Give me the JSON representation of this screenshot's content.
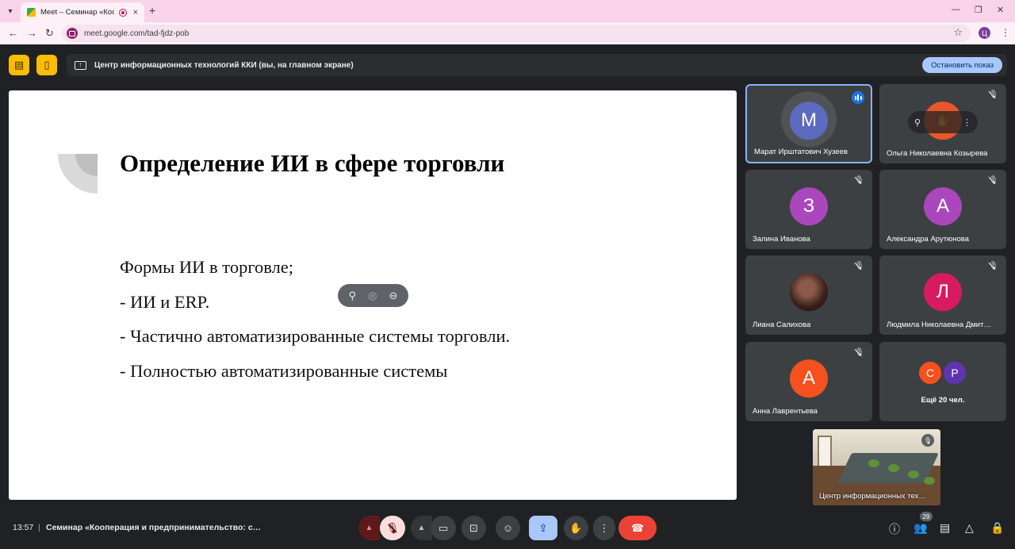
{
  "browser": {
    "tab_title": "Meet – Семинар «Коопера",
    "tab_close": "×",
    "new_tab": "+",
    "url": "meet.google.com/tad-fjdz-pob",
    "profile_initial": "Ц",
    "tab_menu_icon": "chevron-down-icon",
    "window_controls": [
      "minimize-icon",
      "restore-icon",
      "close-icon"
    ]
  },
  "presenting": {
    "banner_text": "Центр информационных технологий ККИ (вы, на главном экране)",
    "stop_label": "Остановить показ"
  },
  "slide": {
    "title": "Определение ИИ в сфере торговли",
    "lines": [
      "Формы ИИ в торговле;",
      "- ИИ и ERP.",
      "- Частично автоматизированные системы торговли.",
      "- Полностью автоматизированные системы"
    ]
  },
  "participants": [
    {
      "initial": "М",
      "name": "Марат Ирштатович Хузеев",
      "color": "#5c6bc0",
      "speaking": true
    },
    {
      "initial": "",
      "name": "Ольга Николаевна Козырева",
      "color": "#e8572a",
      "muted": true
    },
    {
      "initial": "З",
      "name": "Залина Иванова",
      "color": "#ab47bc",
      "muted": true
    },
    {
      "initial": "А",
      "name": "Александра Арутюнова",
      "color": "#ab47bc",
      "muted": true
    },
    {
      "initial": "",
      "name": "Лиана Салихова",
      "color": "#3a1f1a",
      "muted": true
    },
    {
      "initial": "Л",
      "name": "Людмила Николаевна Дмит…",
      "color": "#d81b60",
      "muted": true
    },
    {
      "initial": "А",
      "name": "Анна Лаврентьева",
      "color": "#f4511e",
      "muted": true
    }
  ],
  "more": {
    "label": "Ещё 20 чел.",
    "avatars": [
      {
        "initial": "С",
        "color": "#f4511e"
      },
      {
        "initial": "Р",
        "color": "#5e35b1"
      }
    ]
  },
  "self_view": {
    "label": "Центр информационных тех…"
  },
  "bottom": {
    "time": "13:57",
    "separator": "|",
    "meeting_name": "Семинар «Кооперация и предпринимательство: с…",
    "participant_count": "29"
  }
}
